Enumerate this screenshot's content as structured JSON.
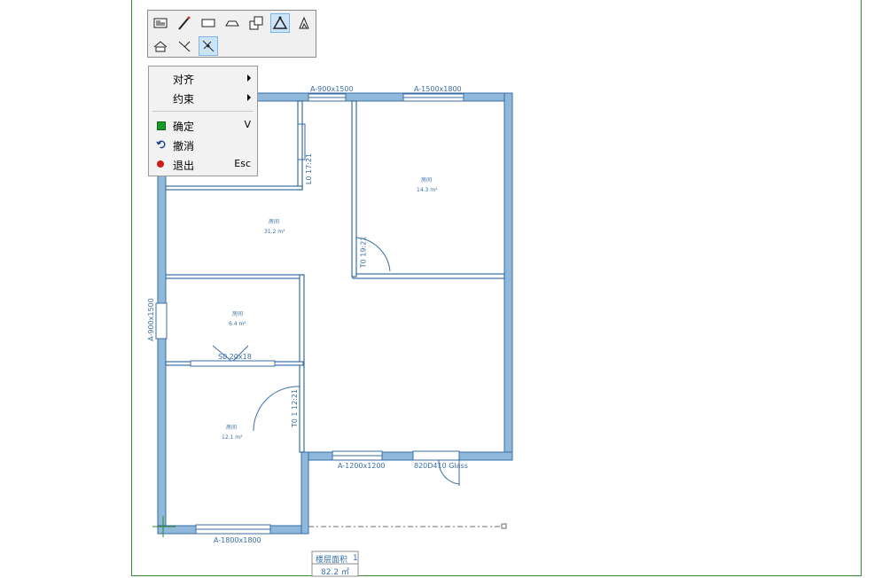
{
  "toolbar": {
    "tools": [
      {
        "name": "text-tool",
        "icon": "text-icon"
      },
      {
        "name": "magic-wand-tool",
        "icon": "magic-wand-icon"
      },
      {
        "name": "rectangle-tool",
        "icon": "rectangle-icon"
      },
      {
        "name": "arc-tool",
        "icon": "arc-icon"
      },
      {
        "name": "offset-polygon-tool",
        "icon": "offset-polygon-icon"
      },
      {
        "name": "triangle-tool",
        "icon": "triangle-icon",
        "active": true
      },
      {
        "name": "polygon-edit-tool",
        "icon": "polygon-edit-icon"
      },
      {
        "name": "roof-tool",
        "icon": "roof-icon"
      },
      {
        "name": "angle-tool",
        "icon": "angle-icon"
      },
      {
        "name": "snap-tool",
        "icon": "snap-icon",
        "active": true
      }
    ]
  },
  "context_menu": {
    "align": "对齐",
    "constrain": "约束",
    "confirm": "确定",
    "confirm_key": "V",
    "undo": "撤消",
    "exit": "退出",
    "exit_key": "Esc"
  },
  "plan": {
    "windows": {
      "top_left": "A-900x1500",
      "top_right": "A-1500x1800",
      "left": "A-900x1500",
      "bottom_mid": "A-1200x1200",
      "bottom_left": "A-1800x1800"
    },
    "doors": {
      "top": "L0 17:21",
      "right_room": "T0 19:21",
      "lower": "T0 1 12:21",
      "glass": "820D410 Glass",
      "sliding": "S0 20x18"
    },
    "rooms": [
      {
        "name": "房间",
        "area": "31.2 m²"
      },
      {
        "name": "房间",
        "area": "14.3 m²"
      },
      {
        "name": "房间",
        "area": "6.4 m²"
      },
      {
        "name": "房间",
        "area": "12.1 m²"
      }
    ],
    "stamp": {
      "title": "楼层面积",
      "number": "1",
      "area": "82.2 ㎡"
    }
  },
  "colors": {
    "wall_fill": "#8fb8da",
    "wall_stroke": "#3a6ea5",
    "frame": "#2e8b2e",
    "menu_bg": "#f2f2f2",
    "active_tool": "#cce4f7"
  }
}
